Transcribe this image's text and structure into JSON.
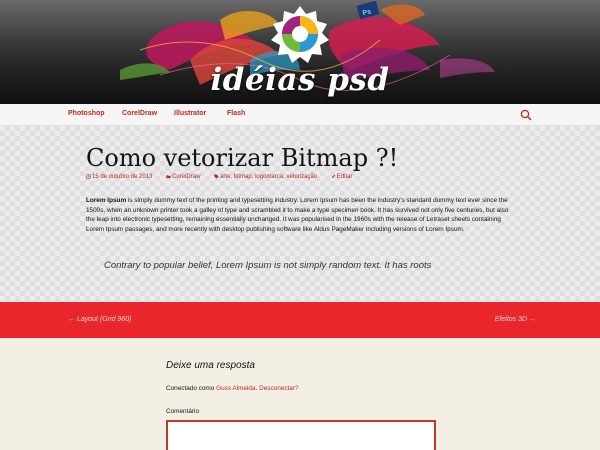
{
  "header": {
    "site_title": "idéias psd"
  },
  "nav": {
    "items": [
      "Photoshop",
      "CorelDraw",
      "Illustrator",
      "Flash"
    ],
    "search_icon": "search-icon"
  },
  "post": {
    "title": "Como vetorizar Bitmap ?!",
    "date": "15 de outubro de 2013",
    "category": "CorelDraw",
    "tags": "arte, bitmap, logomarca, vetorização",
    "edit_label": "Editar",
    "content_lead": "Lorem Ipsum",
    "content_text": " is simply dummy text of the printing and typesetting industry. Lorem Ipsum has been the industry's standard dummy text ever since the 1500s, when an unknown printer took a galley of type and scrambled it to make a type specimen book. It has survived not only five centuries, but also the leap into electronic typesetting, remaining essentially unchanged. It was popularised in the 1960s with the release of Letraset sheets containing Lorem Ipsum passages, and more recently with desktop publishing software like Aldus PageMaker including versions of Lorem Ipsum.",
    "quote": "Contrary to popular belief, Lorem Ipsum is not simply random text. It has roots"
  },
  "post_nav": {
    "prev": "← Layout (Grid 960)",
    "next": "Efeitos 3D →"
  },
  "comments": {
    "reply_title": "Deixe uma resposta",
    "logged_prefix": "Conectado como ",
    "user": "Guss Almeida",
    "logout": "Desconectar?",
    "comment_label": "Comentário",
    "comment_value": ""
  },
  "colors": {
    "accent": "#c02a1b",
    "nav_bar_red": "#e8262b",
    "page_bg": "#f3efe4"
  }
}
